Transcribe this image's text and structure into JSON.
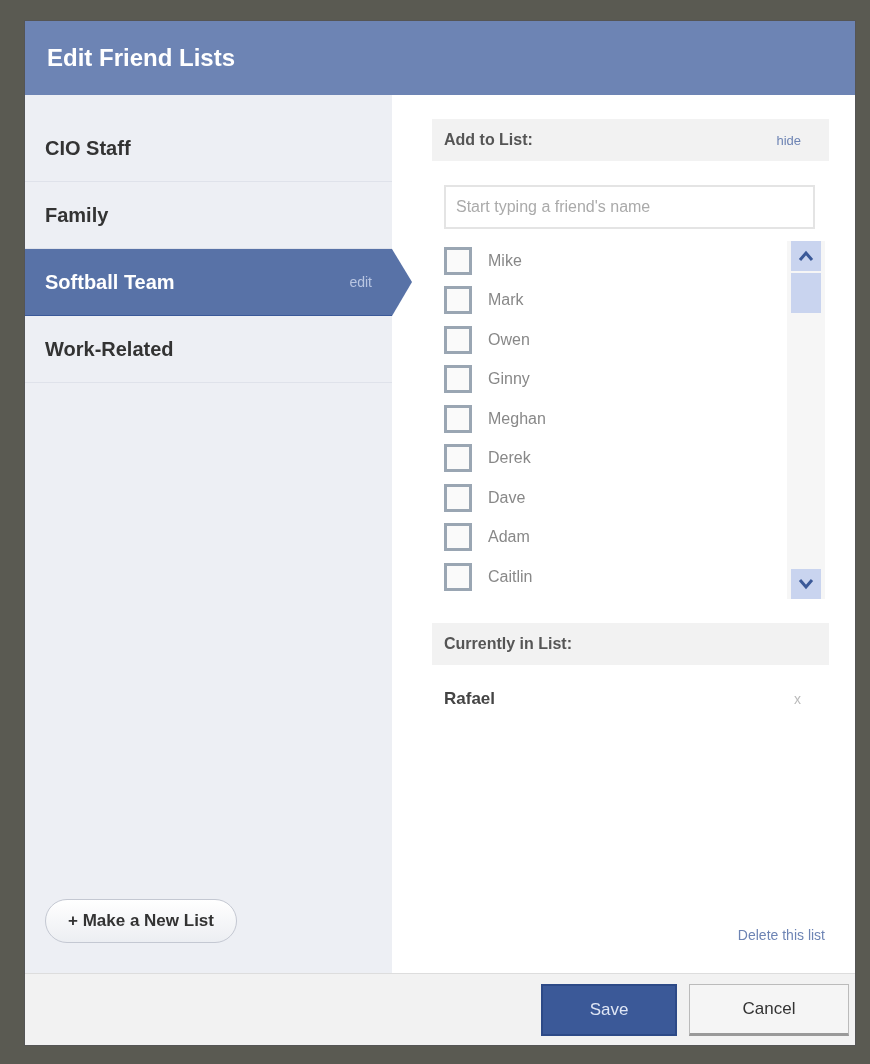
{
  "window": {
    "title": "Edit Friend Lists"
  },
  "sidebar": {
    "items": [
      {
        "label": "CIO Staff",
        "selected": false
      },
      {
        "label": "Family",
        "selected": false
      },
      {
        "label": "Softball Team",
        "selected": true,
        "edit": "edit"
      },
      {
        "label": "Work-Related",
        "selected": false
      }
    ],
    "new_list_button": "+ Make a New List"
  },
  "add_section": {
    "title": "Add to List:",
    "hide_link": "hide",
    "search": {
      "placeholder": "Start typing a friend's name"
    },
    "friends": [
      {
        "name": "Mike",
        "checked": false
      },
      {
        "name": "Mark",
        "checked": false
      },
      {
        "name": "Owen",
        "checked": false
      },
      {
        "name": "Ginny",
        "checked": false
      },
      {
        "name": "Meghan",
        "checked": false
      },
      {
        "name": "Derek",
        "checked": false
      },
      {
        "name": "Dave",
        "checked": false
      },
      {
        "name": "Adam",
        "checked": false
      },
      {
        "name": "Caitlin",
        "checked": false
      }
    ]
  },
  "current_section": {
    "title": "Currently in List:",
    "members": [
      {
        "name": "Rafael",
        "remove": "x"
      }
    ]
  },
  "delete_link": "Delete this list",
  "buttons": [
    {
      "label": "Save",
      "kind": "primary"
    },
    {
      "label": "Cancel",
      "kind": "secondary"
    }
  ]
}
